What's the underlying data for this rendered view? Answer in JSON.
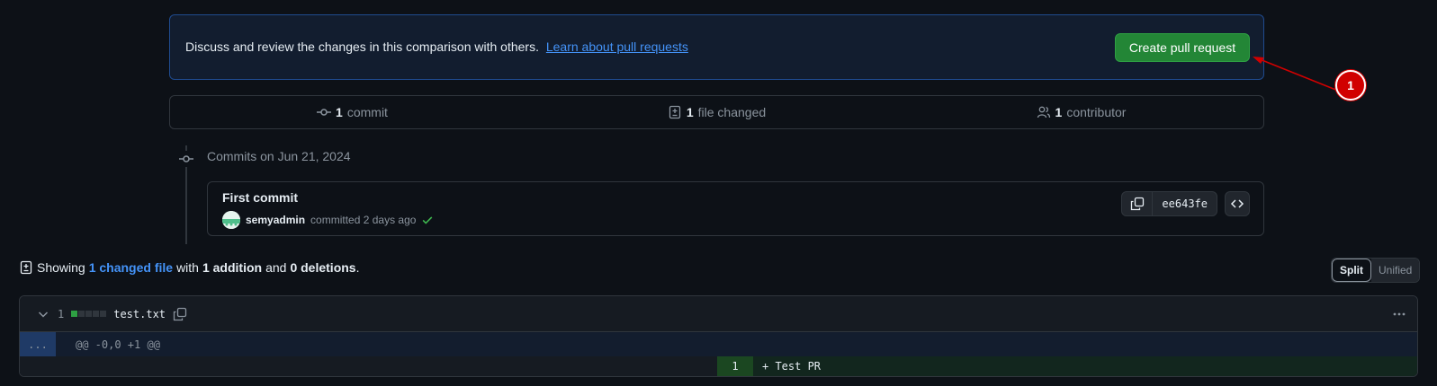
{
  "banner": {
    "text": "Discuss and review the changes in this comparison with others.",
    "link": "Learn about pull requests",
    "button": "Create pull request"
  },
  "annotation": {
    "label": "1"
  },
  "summary": {
    "commits_count": "1",
    "commits_label": "commit",
    "files_count": "1",
    "files_label": "file changed",
    "contributors_count": "1",
    "contributors_label": "contributor"
  },
  "timeline": {
    "date_heading": "Commits on Jun 21, 2024"
  },
  "commit": {
    "title": "First commit",
    "author": "semyadmin",
    "action": "committed 2 days ago",
    "sha": "ee643fe"
  },
  "showing": {
    "prefix": "Showing",
    "changed": "1 changed file",
    "with": "with",
    "additions": "1 addition",
    "and": "and",
    "deletions": "0 deletions",
    "end": "."
  },
  "view_toggle": {
    "split": "Split",
    "unified": "Unified"
  },
  "file": {
    "count": "1",
    "name": "test.txt",
    "hunk_expand": "...",
    "hunk_header": "@@ -0,0 +1 @@",
    "line_number": "1",
    "line_code": "+ Test PR"
  },
  "colors": {
    "accent": "#4493f8",
    "success": "#238636",
    "annotation": "#d10000"
  }
}
